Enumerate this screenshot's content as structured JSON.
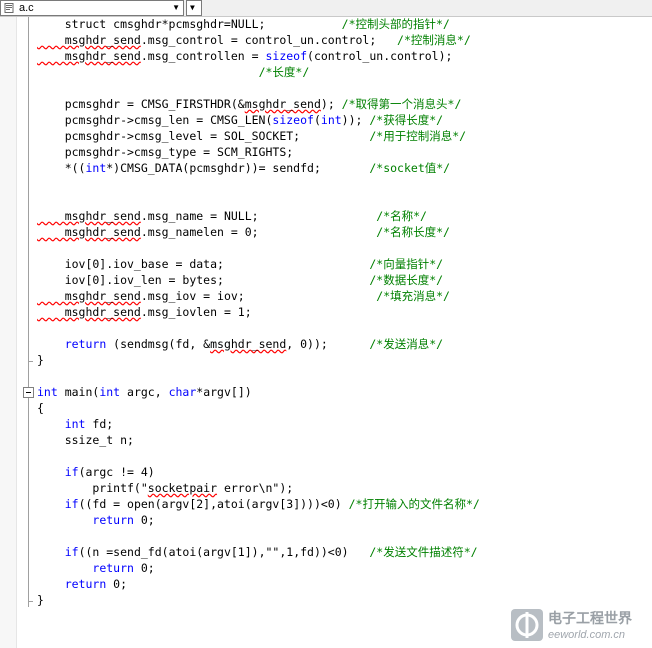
{
  "toolbar": {
    "file_name": "a.c"
  },
  "code": [
    [
      {
        "t": "    struct cmsghdr*pcmsghdr=NULL;           "
      },
      {
        "t": "/*控制头部的指针*/",
        "c": "cm"
      }
    ],
    [
      {
        "t": "    msghdr_send",
        "c": "sq"
      },
      {
        "t": ".msg_control = control_un.control;   "
      },
      {
        "t": "/*控制消息*/",
        "c": "cm"
      }
    ],
    [
      {
        "t": "    msghdr_send",
        "c": "sq"
      },
      {
        "t": ".msg_controllen = "
      },
      {
        "t": "sizeof",
        "c": "kw"
      },
      {
        "t": "(control_un.control);"
      }
    ],
    [
      {
        "t": "                                "
      },
      {
        "t": "/*长度*/",
        "c": "cm"
      }
    ],
    [
      {
        "t": ""
      }
    ],
    [
      {
        "t": "    pcmsghdr = CMSG_FIRSTHDR(&"
      },
      {
        "t": "msghdr_send",
        "c": "sq"
      },
      {
        "t": "); "
      },
      {
        "t": "/*取得第一个消息头*/",
        "c": "cm"
      }
    ],
    [
      {
        "t": "    pcmsghdr->cmsg_len = CMSG_LEN("
      },
      {
        "t": "sizeof",
        "c": "kw"
      },
      {
        "t": "("
      },
      {
        "t": "int",
        "c": "kw"
      },
      {
        "t": ")); "
      },
      {
        "t": "/*获得长度*/",
        "c": "cm"
      }
    ],
    [
      {
        "t": "    pcmsghdr->cmsg_level = SOL_SOCKET;          "
      },
      {
        "t": "/*用于控制消息*/",
        "c": "cm"
      }
    ],
    [
      {
        "t": "    pcmsghdr->cmsg_type = SCM_RIGHTS;"
      }
    ],
    [
      {
        "t": "    *(("
      },
      {
        "t": "int",
        "c": "kw"
      },
      {
        "t": "*)CMSG_DATA(pcmsghdr))= sendfd;       "
      },
      {
        "t": "/*socket值*/",
        "c": "cm"
      }
    ],
    [
      {
        "t": ""
      }
    ],
    [
      {
        "t": ""
      }
    ],
    [
      {
        "t": "    msghdr_send",
        "c": "sq"
      },
      {
        "t": ".msg_name = NULL;                 "
      },
      {
        "t": "/*名称*/",
        "c": "cm"
      }
    ],
    [
      {
        "t": "    msghdr_send",
        "c": "sq"
      },
      {
        "t": ".msg_namelen = 0;                 "
      },
      {
        "t": "/*名称长度*/",
        "c": "cm"
      }
    ],
    [
      {
        "t": ""
      }
    ],
    [
      {
        "t": "    iov[0].iov_base = data;                     "
      },
      {
        "t": "/*向量指针*/",
        "c": "cm"
      }
    ],
    [
      {
        "t": "    iov[0].iov_len = bytes;                     "
      },
      {
        "t": "/*数据长度*/",
        "c": "cm"
      }
    ],
    [
      {
        "t": "    msghdr_send",
        "c": "sq"
      },
      {
        "t": ".msg_iov = iov;                   "
      },
      {
        "t": "/*填充消息*/",
        "c": "cm"
      }
    ],
    [
      {
        "t": "    msghdr_send",
        "c": "sq"
      },
      {
        "t": ".msg_iovlen = 1;"
      }
    ],
    [
      {
        "t": ""
      }
    ],
    [
      {
        "t": "    "
      },
      {
        "t": "return",
        "c": "kw"
      },
      {
        "t": " (sendmsg(fd, &"
      },
      {
        "t": "msghdr_send",
        "c": "sq"
      },
      {
        "t": ", 0));      "
      },
      {
        "t": "/*发送消息*/",
        "c": "cm"
      }
    ],
    [
      {
        "t": "}"
      }
    ],
    [
      {
        "t": ""
      }
    ],
    [
      {
        "t": "int",
        "c": "kw"
      },
      {
        "t": " main("
      },
      {
        "t": "int",
        "c": "kw"
      },
      {
        "t": " argc, "
      },
      {
        "t": "char",
        "c": "kw"
      },
      {
        "t": "*argv[])"
      }
    ],
    [
      {
        "t": "{"
      }
    ],
    [
      {
        "t": "    "
      },
      {
        "t": "int",
        "c": "kw"
      },
      {
        "t": " fd;"
      }
    ],
    [
      {
        "t": "    ssize_t n;"
      }
    ],
    [
      {
        "t": ""
      }
    ],
    [
      {
        "t": "    "
      },
      {
        "t": "if",
        "c": "kw"
      },
      {
        "t": "(argc != 4)"
      }
    ],
    [
      {
        "t": "        printf(\""
      },
      {
        "t": "socketpair",
        "c": "sq"
      },
      {
        "t": " error\\n\");"
      }
    ],
    [
      {
        "t": "    "
      },
      {
        "t": "if",
        "c": "kw"
      },
      {
        "t": "((fd = open(argv[2],atoi(argv[3])))<0) "
      },
      {
        "t": "/*打开输入的文件名称*/",
        "c": "cm"
      }
    ],
    [
      {
        "t": "        "
      },
      {
        "t": "return",
        "c": "kw"
      },
      {
        "t": " 0;"
      }
    ],
    [
      {
        "t": ""
      }
    ],
    [
      {
        "t": "    "
      },
      {
        "t": "if",
        "c": "kw"
      },
      {
        "t": "((n =send_fd(atoi(argv[1]),\"\",1,fd))<0)   "
      },
      {
        "t": "/*发送文件描述符*/",
        "c": "cm"
      }
    ],
    [
      {
        "t": "        "
      },
      {
        "t": "return",
        "c": "kw"
      },
      {
        "t": " 0;"
      }
    ],
    [
      {
        "t": "    "
      },
      {
        "t": "return",
        "c": "kw"
      },
      {
        "t": " 0;"
      }
    ],
    [
      {
        "t": "}"
      }
    ]
  ],
  "watermark": {
    "title": "电子工程世界",
    "url": "eeworld.com.cn"
  },
  "colors": {
    "keyword": "#0000ff",
    "comment": "#008000",
    "squiggle": "#ff0000"
  }
}
